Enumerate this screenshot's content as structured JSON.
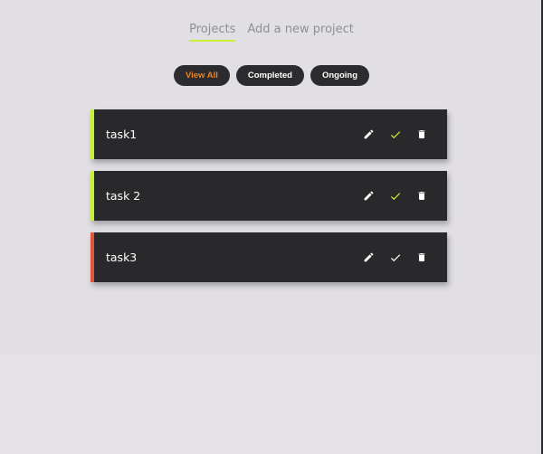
{
  "nav": {
    "projects_label": "Projects",
    "add_project_label": "Add a new project"
  },
  "filters": {
    "view_all": "View All",
    "completed": "Completed",
    "ongoing": "Ongoing",
    "active": "view_all"
  },
  "tasks": [
    {
      "title": "task1",
      "status": "completed"
    },
    {
      "title": "task 2",
      "status": "completed"
    },
    {
      "title": "task3",
      "status": "ongoing"
    }
  ],
  "colors": {
    "background": "#e1dfe3",
    "card": "#29282b",
    "accent_green": "#c6f135",
    "accent_red": "#e2533b",
    "active_filter_text": "#f0821e"
  },
  "icons": {
    "edit": "pencil-icon",
    "complete": "check-icon",
    "delete": "trash-icon"
  }
}
